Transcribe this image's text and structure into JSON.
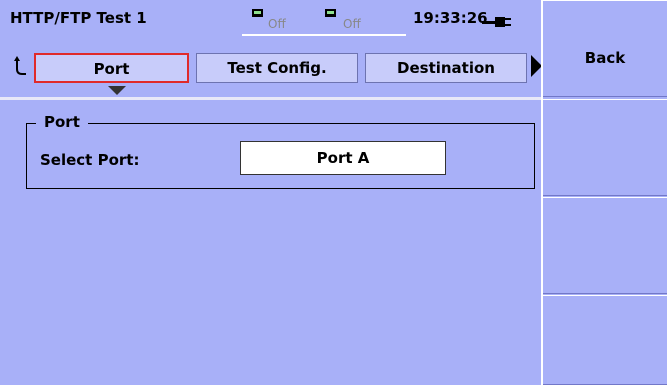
{
  "title_bar": {
    "title": "HTTP/FTP Test 1",
    "led1_status": "Off",
    "led2_status": "Off",
    "time": "19:33:26",
    "power_icon": "plug-icon"
  },
  "tabs": {
    "loop_icon": "loop-arrow-icon",
    "items": [
      {
        "label": "Port",
        "selected": true
      },
      {
        "label": "Test Config.",
        "selected": false
      },
      {
        "label": "Destination",
        "selected": false
      }
    ],
    "next_icon": "triangle-right-icon"
  },
  "port_group": {
    "title": "Port",
    "select_label": "Select Port:",
    "select_value": "Port A"
  },
  "softkeys": {
    "back_label": "Back"
  },
  "colors": {
    "background": "#a8b0f8",
    "selected_tab_border": "#e02a2a",
    "led_on": "#8ee08e"
  }
}
